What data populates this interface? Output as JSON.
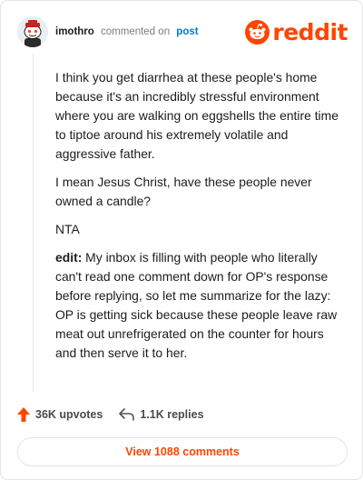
{
  "header": {
    "username": "imothro",
    "action": "commented on",
    "target": "post",
    "brand": "reddit",
    "brand_color": "#ff4500",
    "avatar_icon": "snoo-avatar-icon",
    "logo_icon": "reddit-alien-icon"
  },
  "comment": {
    "paragraphs": [
      "I think you get diarrhea at these people's home because it's an incredibly stressful environment where you are walking on eggshells the entire time to tiptoe around his extremely volatile and aggressive father.",
      "I mean Jesus Christ, have these people never owned a candle?",
      "NTA"
    ],
    "edit_label": "edit:",
    "edit_text": " My inbox is filling with people who literally can't read one comment down for OP's response before replying, so let me summarize for the lazy: OP is getting sick because these people leave raw meat out unrefrigerated on the counter for hours and then serve it to her."
  },
  "footer": {
    "upvotes": "36K upvotes",
    "replies": "1.1K replies",
    "upvote_icon": "upvote-arrow-icon",
    "reply_icon": "reply-arrow-icon",
    "view_comments": "View 1088 comments"
  }
}
